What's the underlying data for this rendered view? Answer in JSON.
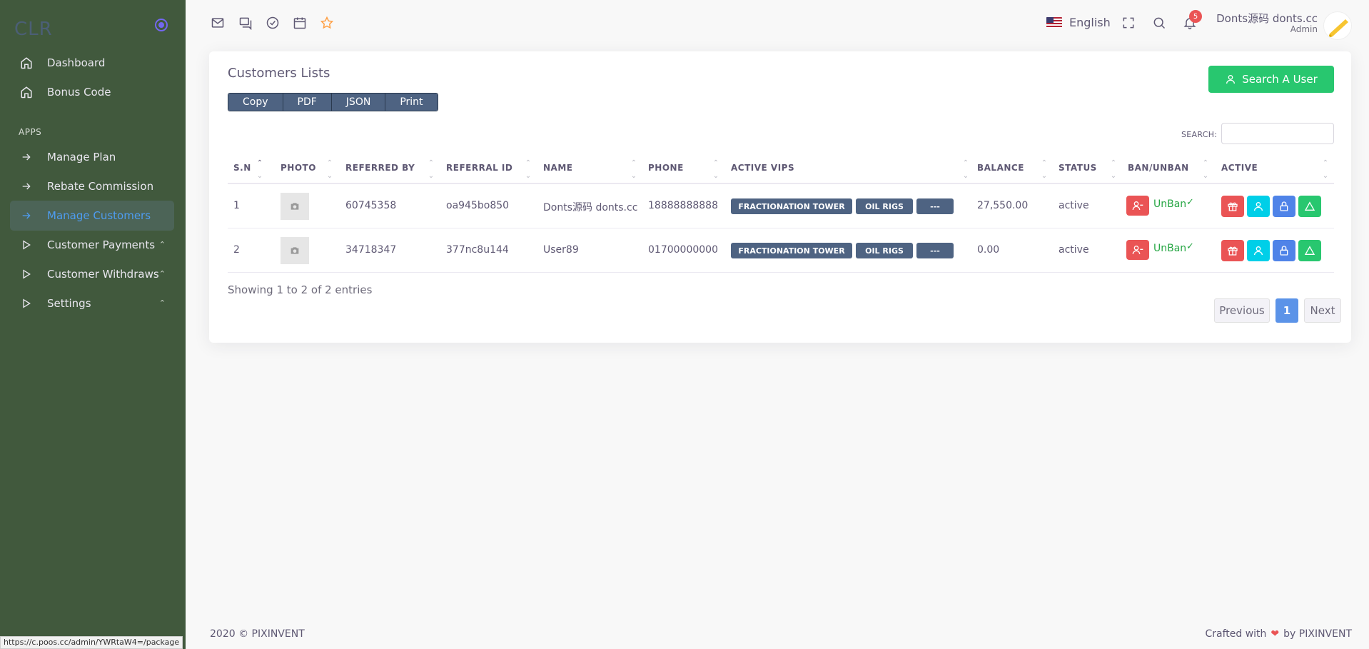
{
  "app": {
    "brand": "CLR"
  },
  "sidebar": {
    "section_label": "APPS",
    "items": [
      {
        "label": "Dashboard",
        "icon": "home-icon"
      },
      {
        "label": "Bonus Code",
        "icon": "home-icon"
      },
      {
        "label": "Manage Plan",
        "icon": "arrow-right-icon"
      },
      {
        "label": "Rebate Commission",
        "icon": "arrow-right-icon"
      },
      {
        "label": "Manage Customers",
        "icon": "arrow-right-icon",
        "active": true
      },
      {
        "label": "Customer Payments",
        "icon": "play-icon"
      },
      {
        "label": "Customer Withdraws",
        "icon": "play-icon"
      },
      {
        "label": "Settings",
        "icon": "play-icon"
      }
    ]
  },
  "header": {
    "language": "English",
    "notification_count": "5",
    "user_name": "Donts源码 donts.cc",
    "user_role": "Admin"
  },
  "card": {
    "title": "Customers Lists",
    "export_buttons": [
      "Copy",
      "PDF",
      "JSON",
      "Print"
    ],
    "search_user_label": "Search A User",
    "search_label": "SEARCH:",
    "search_value": ""
  },
  "table": {
    "headers": [
      "S.N",
      "PHOTO",
      "REFERRED BY",
      "REFERRAL ID",
      "NAME",
      "PHONE",
      "ACTIVE VIPS",
      "BALANCE",
      "STATUS",
      "BAN/UNBAN",
      "ACTIVE"
    ],
    "rows": [
      {
        "sn": "1",
        "referred_by": "60745358",
        "referral_id": "oa945bo850",
        "name": "Donts源码 donts.cc",
        "phone": "18888888888",
        "vips": [
          "FRACTIONATION TOWER",
          "OIL RIGS",
          "---"
        ],
        "balance": "27,550.00",
        "status": "active",
        "ban_label": "UnBan"
      },
      {
        "sn": "2",
        "referred_by": "34718347",
        "referral_id": "377nc8u144",
        "name": "User89",
        "phone": "01700000000",
        "vips": [
          "FRACTIONATION TOWER",
          "OIL RIGS",
          "---"
        ],
        "balance": "0.00",
        "status": "active",
        "ban_label": "UnBan"
      }
    ],
    "info": "Showing 1 to 2 of 2 entries",
    "pagination": {
      "previous": "Previous",
      "current": "1",
      "next": "Next"
    }
  },
  "footer": {
    "copyright": "2020 © PIXINVENT",
    "crafted_prefix": "Crafted with",
    "crafted_suffix": "by PIXINVENT"
  },
  "status_bar_url": "https://c.poos.cc/admin/YWRtaW4=/package",
  "colors": {
    "sidebar_bg": "#41593d",
    "accent_green": "#28c76f",
    "danger": "#ea5455",
    "vip_badge": "#4e6382",
    "action_red": "#ea5455",
    "action_cyan": "#00cfe8",
    "action_blue": "#4f83e8",
    "action_green": "#28c76f"
  }
}
